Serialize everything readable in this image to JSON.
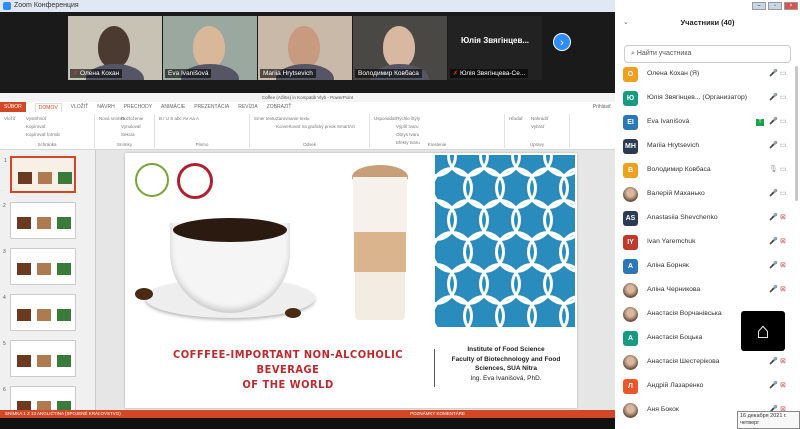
{
  "window": {
    "title": "Zoom Конференция"
  },
  "videos": [
    {
      "name": "Олена Кохан",
      "muted": true,
      "bg": "#c8c2b4",
      "face": "#4a3a30"
    },
    {
      "name": "Eva Ivanišová",
      "muted": false,
      "bg": "#9aa8a0",
      "face": "#d9b89a"
    },
    {
      "name": "Mariia Hrytsevich",
      "muted": false,
      "bg": "#c9b9a8",
      "face": "#c89a80"
    },
    {
      "name": "Володимир Ковбаса",
      "muted": false,
      "bg": "#4a4844",
      "face": "#d8b8a0"
    },
    {
      "name": "Юлія Звягінцева-Се...",
      "muted": true,
      "big_label": "Юлія Звягінцев..."
    }
  ],
  "powerpoint": {
    "title": "Coffee (Ažiltis) in Kompatib Vlyb - PowerPoint",
    "tabs": [
      "SÚBOR",
      "DOMOV",
      "VLOŽIŤ",
      "NÁVRH",
      "PRECHODY",
      "ANIMÁCIE",
      "PREZENTÁCIA",
      "REVÍZIA",
      "ZOBRAZIŤ"
    ],
    "user": "Prihlásiť",
    "groups": [
      {
        "label": "Schránka",
        "items": [
          "Vložiť",
          "Vystrihnúť",
          "Kopírovať",
          "Kopírovať formát"
        ]
      },
      {
        "label": "Snímky",
        "items": [
          "Nová snímka",
          "Rozloženie",
          "Vynulovať",
          "Sekcia"
        ]
      },
      {
        "label": "Písmo",
        "items": [
          "B I U S abc AV Aa A"
        ]
      },
      {
        "label": "Odsek",
        "items": [
          "Smer textu",
          "Zarovnanie textu",
          "Konvertovať na grafický prvok SmartArt"
        ]
      },
      {
        "label": "Kreslenie",
        "items": [
          "Usporiadať",
          "Rýchle štýly",
          "Výplň tvaru",
          "Obrys tvaru",
          "Efekty tvaru"
        ]
      },
      {
        "label": "Úpravy",
        "items": [
          "Hľadať",
          "Nahradiť",
          "Vybrať"
        ]
      }
    ],
    "slide_numbers": [
      "1",
      "2",
      "3",
      "4",
      "5",
      "6"
    ],
    "slide": {
      "title_line1": "COFFFEE-IMPORTANT NON-ALCOHOLIC BEVERAGE",
      "title_line2": "OF THE WORLD",
      "institute": [
        "Institute of Food Science",
        "Faculty of Biotechnology and Food",
        "Sciences, SUA Nitra",
        "Ing. Eva Ivanišová, PhD."
      ]
    },
    "status_left": "SNÍMKA 1 Z 13   ANGLIČTINA (SPOJENÉ KRÁĽOVSTVO)",
    "status_right": "POZNÁMKY   KOMENTÁRE"
  },
  "panel": {
    "title": "Участники (40)",
    "search_placeholder": "Найти участника",
    "participants": [
      {
        "initials": "О",
        "name": "Олена Кохан (Я)",
        "color": "#f0a020",
        "mic": "off",
        "cam": "novideo"
      },
      {
        "initials": "Ю",
        "name": "Юлія Звягінцев...  (Организатор)",
        "color": "#179a80",
        "mic": "off",
        "cam": "novideo"
      },
      {
        "initials": "EI",
        "name": "Eva Ivanišová",
        "color": "#2a78b8",
        "mic": "on",
        "cam": "novideo",
        "badge": "T"
      },
      {
        "initials": "MH",
        "name": "Mariia Hrytsevich",
        "color": "#2b3a55",
        "mic": "on",
        "cam": "novideo"
      },
      {
        "initials": "В",
        "name": "Володимир Ковбаса",
        "color": "#f0a020",
        "mic": "talking",
        "cam": "novideo"
      },
      {
        "initials": "",
        "name": "Валерій Маханько",
        "color": "photo",
        "mic": "on",
        "cam": "novideo"
      },
      {
        "initials": "AS",
        "name": "Anastasiia Shevchenko",
        "color": "#2b3a55",
        "mic": "off",
        "cam": "off"
      },
      {
        "initials": "IY",
        "name": "Ivan Yaremchuk",
        "color": "#c0392b",
        "mic": "off",
        "cam": "off"
      },
      {
        "initials": "А",
        "name": "Аліна Борняк",
        "color": "#2a78b8",
        "mic": "off",
        "cam": "off"
      },
      {
        "initials": "",
        "name": "Аліна Черникова",
        "color": "photo",
        "mic": "off",
        "cam": "off"
      },
      {
        "initials": "",
        "name": "Анастасія Ворчанівська",
        "color": "photo",
        "mic": "off",
        "cam": "off"
      },
      {
        "initials": "А",
        "name": "Анастасія Боцька",
        "color": "#179a80",
        "mic": "off",
        "cam": "off"
      },
      {
        "initials": "",
        "name": "Анастасія Шестерікова",
        "color": "photo",
        "mic": "off",
        "cam": "off"
      },
      {
        "initials": "Л",
        "name": "Андрій Лазаренко",
        "color": "#e8582a",
        "mic": "off",
        "cam": "off"
      },
      {
        "initials": "",
        "name": "Аня Бокок",
        "color": "photo",
        "mic": "off",
        "cam": "off"
      }
    ]
  },
  "tooltip": {
    "date": "16 декабря 2021 г.",
    "day": "четверг"
  }
}
